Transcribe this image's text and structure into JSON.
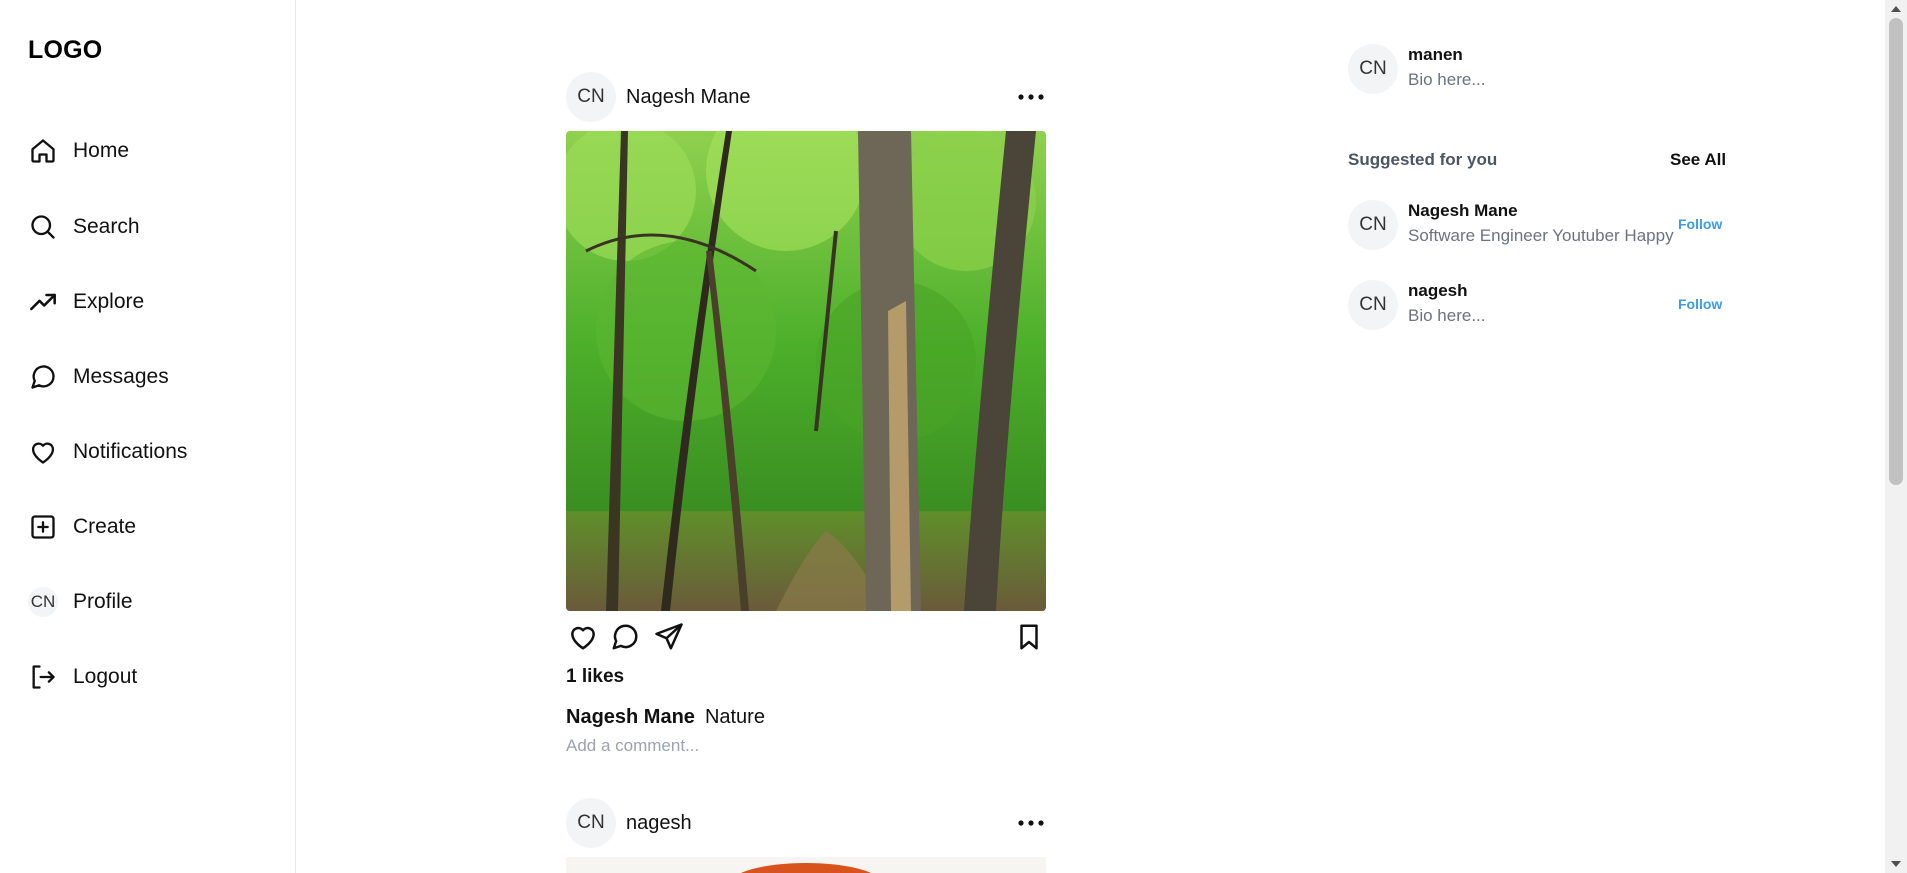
{
  "sidebar": {
    "logo": "LOGO",
    "items": [
      {
        "label": "Home",
        "icon": "home-icon"
      },
      {
        "label": "Search",
        "icon": "search-icon"
      },
      {
        "label": "Explore",
        "icon": "trending-icon"
      },
      {
        "label": "Messages",
        "icon": "message-circle-icon"
      },
      {
        "label": "Notifications",
        "icon": "heart-icon"
      },
      {
        "label": "Create",
        "icon": "plus-square-icon"
      },
      {
        "label": "Profile",
        "icon": "avatar",
        "avatar_text": "CN"
      },
      {
        "label": "Logout",
        "icon": "logout-icon"
      }
    ]
  },
  "feed": {
    "posts": [
      {
        "avatar_text": "CN",
        "username": "Nagesh Mane",
        "image": "forest-photo",
        "likes_text": "1 likes",
        "caption_user": "Nagesh Mane",
        "caption_text": "Nature",
        "comment_placeholder": "Add a comment..."
      },
      {
        "avatar_text": "CN",
        "username": "nagesh",
        "image": "orange-photo"
      }
    ]
  },
  "right_panel": {
    "current_user": {
      "avatar_text": "CN",
      "name": "manen",
      "bio": "Bio here..."
    },
    "suggested_title": "Suggested for you",
    "see_all": "See All",
    "suggestions": [
      {
        "avatar_text": "CN",
        "name": "Nagesh Mane",
        "bio": "Software Engineer Youtuber Happy",
        "follow_label": "Follow"
      },
      {
        "avatar_text": "CN",
        "name": "nagesh",
        "bio": "Bio here...",
        "follow_label": "Follow"
      }
    ]
  },
  "colors": {
    "follow": "#3b9be6",
    "border": "#e5e7eb",
    "avatar_bg": "#f3f4f6",
    "muted_text": "#6b7280"
  }
}
